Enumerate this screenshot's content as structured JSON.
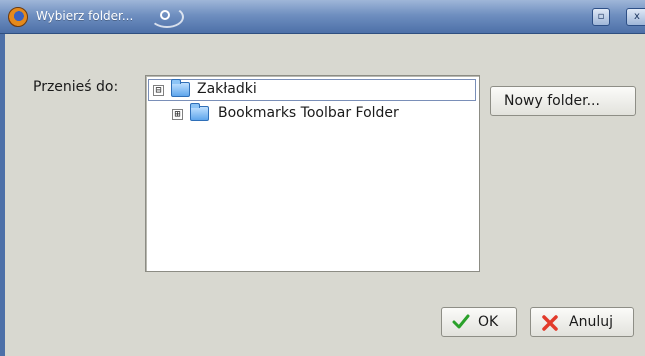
{
  "window": {
    "title": "Wybierz folder...",
    "app_icon": "firefox-icon",
    "maximize_icon": "maximize-icon",
    "close_icon": "close-icon",
    "maximize_glyph": "▫",
    "close_glyph": "x"
  },
  "dialog": {
    "move_to_label": "Przenieś do:",
    "new_folder_label": "Nowy folder...",
    "ok_label": "OK",
    "cancel_label": "Anuluj"
  },
  "tree": {
    "items": [
      {
        "label": "Zakładki",
        "expander": "⊟",
        "icon": "folder-icon",
        "selected": true
      },
      {
        "label": "Bookmarks Toolbar Folder",
        "expander": "⊞",
        "icon": "folder-icon",
        "selected": false
      }
    ]
  },
  "colors": {
    "titlebar": "#4d70a8",
    "dialog_bg": "#d8d8d0",
    "ok_check": "#2aa12a",
    "cancel_x": "#e23a2a"
  }
}
